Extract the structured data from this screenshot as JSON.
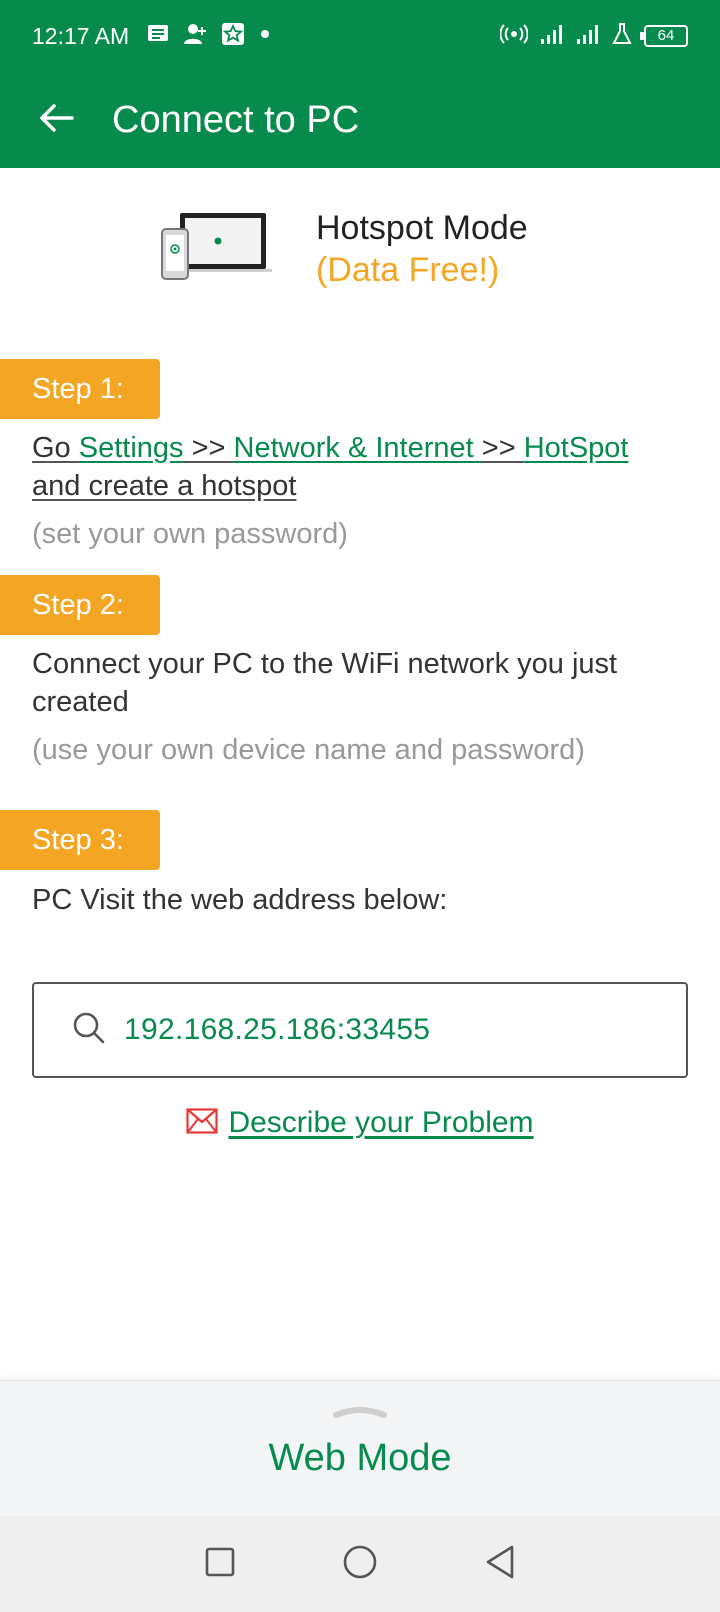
{
  "status_bar": {
    "time": "12:17 AM",
    "battery": "64",
    "left_icons": [
      "message-icon",
      "add-contact-icon",
      "star-badge-icon",
      "dot-icon"
    ],
    "right_icons": [
      "hotspot-signal-icon",
      "cellular-signal-icon",
      "cellular-signal-2-icon",
      "flask-icon",
      "battery-icon"
    ]
  },
  "app_bar": {
    "title": "Connect to PC",
    "back_icon": "arrow-left-icon"
  },
  "hotspot": {
    "title": "Hotspot Mode",
    "subtitle": "(Data Free!)",
    "illustration_icon": "laptop-phone-icon"
  },
  "steps": [
    {
      "label": "Step 1:",
      "text_go": "Go ",
      "link_settings": "Settings",
      "sep1": " >> ",
      "link_network": "Network & Internet ",
      "sep2": ">> ",
      "link_hotspot": "HotSpot",
      "text_rest": "and create a hotspot",
      "hint": "(set your own password)"
    },
    {
      "label": "Step 2:",
      "text": "Connect your PC to the WiFi network you just created",
      "hint": "(use your own device name and password)"
    },
    {
      "label": "Step 3:",
      "text": "PC Visit the web address below:"
    }
  ],
  "address": {
    "value": "192.168.25.186:33455",
    "icon": "search-icon"
  },
  "describe_link": {
    "label": "Describe your Problem",
    "icon": "mail-icon"
  },
  "bottom_sheet": {
    "label": "Web Mode",
    "handle_icon": "chevron-up-icon"
  },
  "nav_bar": {
    "icons": [
      "recents-square-icon",
      "home-circle-icon",
      "back-triangle-icon"
    ]
  },
  "colors": {
    "brand_green": "#078b4d",
    "accent_orange": "#f5a524",
    "hint_gray": "#999999",
    "mail_red": "#e53935"
  }
}
